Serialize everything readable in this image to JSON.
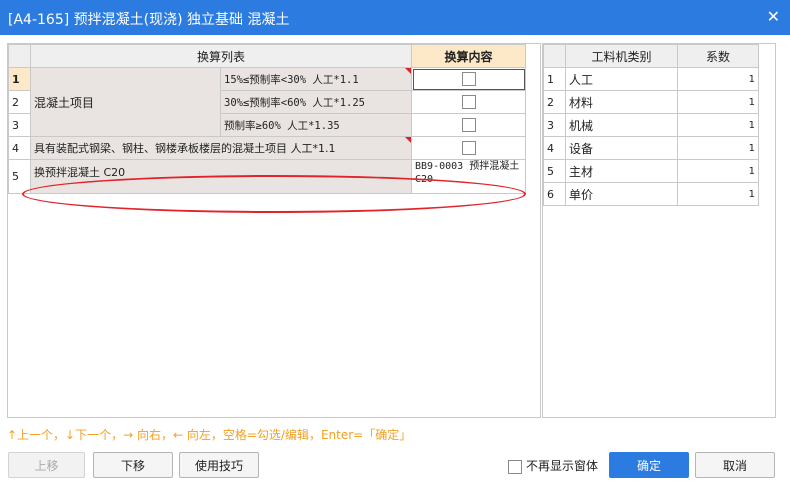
{
  "window": {
    "title": "[A4-165] 预拌混凝土(现浇) 独立基础 混凝土"
  },
  "left_table": {
    "headers": {
      "list": "换算列表",
      "content": "换算内容"
    },
    "rows": [
      {
        "num": "1",
        "group": "混凝土项目",
        "item": "15%≤预制率<30% 人工*1.1"
      },
      {
        "num": "2",
        "item": "30%≤预制率<60% 人工*1.25"
      },
      {
        "num": "3",
        "item": "预制率≥60% 人工*1.35"
      },
      {
        "num": "4",
        "item": "具有装配式钢梁、钢柱、钢楼承板楼层的混凝土项目 人工*1.1"
      },
      {
        "num": "5",
        "item": "换预拌混凝土 C20",
        "content": "BB9-0003  预拌混凝土 C20"
      }
    ]
  },
  "right_table": {
    "headers": {
      "category": "工料机类别",
      "factor": "系数"
    },
    "rows": [
      {
        "num": "1",
        "category": "人工",
        "factor": "1"
      },
      {
        "num": "2",
        "category": "材料",
        "factor": "1"
      },
      {
        "num": "3",
        "category": "机械",
        "factor": "1"
      },
      {
        "num": "4",
        "category": "设备",
        "factor": "1"
      },
      {
        "num": "5",
        "category": "主材",
        "factor": "1"
      },
      {
        "num": "6",
        "category": "单价",
        "factor": "1"
      }
    ]
  },
  "hint": "↑上一个，↓下一个，→ 向右，← 向左，空格=勾选/编辑，Enter=「确定」",
  "buttons": {
    "move_up": "上移",
    "move_down": "下移",
    "tips": "使用技巧",
    "no_show": "不再显示窗体",
    "ok": "确定",
    "cancel": "取消"
  },
  "colors": {
    "title_bar": "#2b7be0",
    "header_highlight": "#fde9c7",
    "annotation_oval": "#e0252a",
    "hint_text": "#f4a020"
  }
}
